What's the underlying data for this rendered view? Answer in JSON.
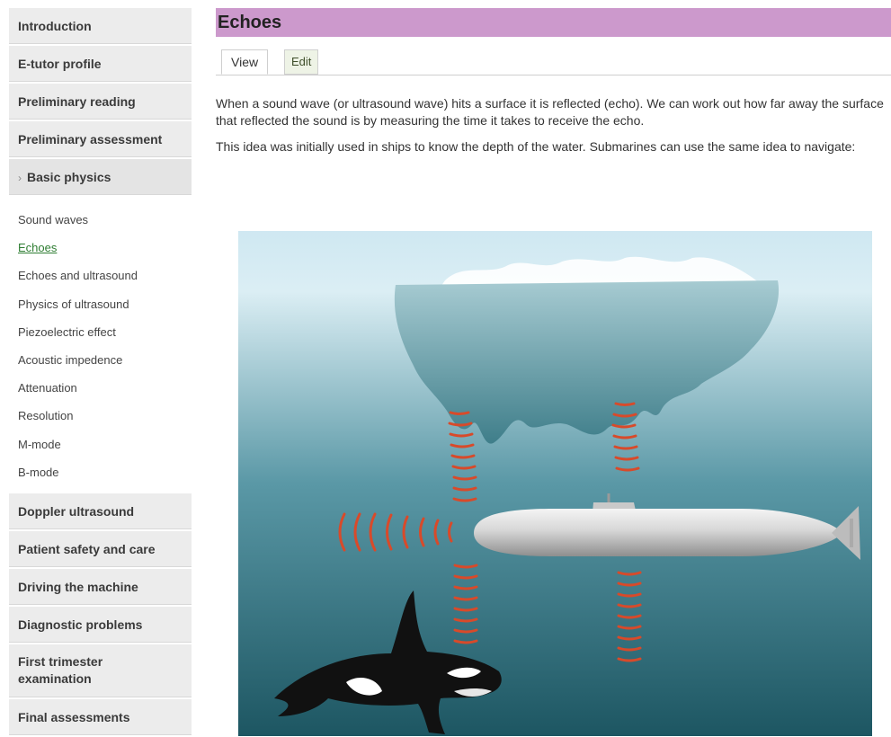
{
  "sidebar": {
    "sections_top": [
      {
        "label": "Introduction"
      },
      {
        "label": "E-tutor profile"
      },
      {
        "label": "Preliminary reading"
      },
      {
        "label": "Preliminary assessment"
      }
    ],
    "active_section": {
      "chevron": "›",
      "label": "Basic physics"
    },
    "sub_items": [
      {
        "label": "Sound waves"
      },
      {
        "label": "Echoes"
      },
      {
        "label": "Echoes and ultrasound"
      },
      {
        "label": "Physics of ultrasound"
      },
      {
        "label": "Piezoelectric effect"
      },
      {
        "label": "Acoustic impedence"
      },
      {
        "label": "Attenuation"
      },
      {
        "label": "Resolution"
      },
      {
        "label": "M-mode"
      },
      {
        "label": "B-mode"
      }
    ],
    "sections_bottom": [
      {
        "label": "Doppler ultrasound"
      },
      {
        "label": "Patient safety and care"
      },
      {
        "label": "Driving the machine"
      },
      {
        "label": "Diagnostic problems"
      },
      {
        "label_line1": "First trimester",
        "label_line2": "examination"
      },
      {
        "label": "Final assessments"
      }
    ]
  },
  "page": {
    "title": "Echoes",
    "tabs": {
      "view": "View",
      "edit": "Edit"
    },
    "paragraphs": [
      "When a sound wave (or ultrasound wave) hits a surface it is reflected (echo). We can work out how far away the surface that reflected the sound is by measuring the time it takes to receive the echo.",
      "This idea was initially used in ships to know the depth of the water. Submarines can use the same idea to navigate:"
    ]
  },
  "colors": {
    "title_bar": "#cc99cc",
    "current_link": "#2e7d32",
    "sound_wave": "#d84a2a",
    "water_top": "#dcecf2",
    "water_bottom": "#1f5a66"
  },
  "figure": {
    "icons": [
      "iceberg-icon",
      "submarine-icon",
      "orca-icon",
      "sound-wave-icon"
    ]
  }
}
